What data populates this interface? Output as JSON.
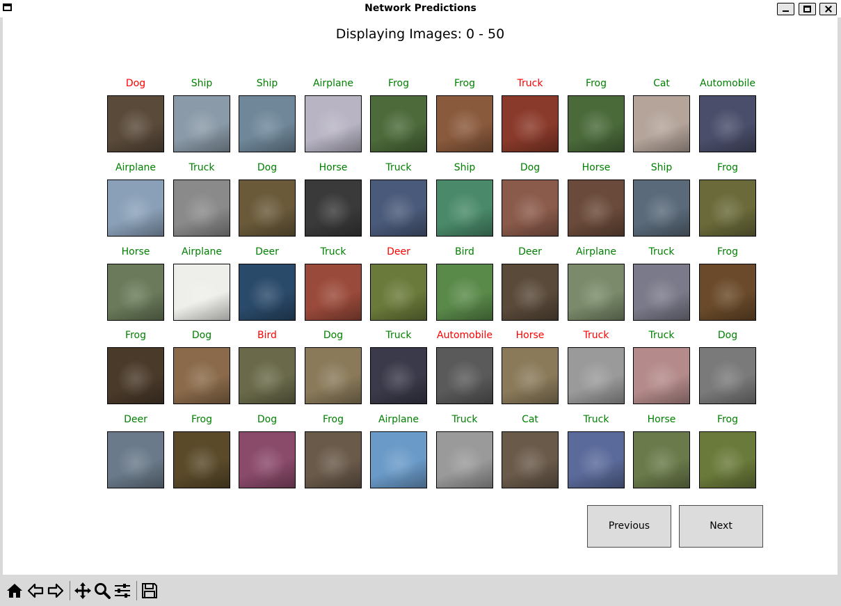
{
  "window": {
    "title": "Network Predictions"
  },
  "figure": {
    "title": "Displaying Images: 0 - 50"
  },
  "colors": {
    "correct": "#008000",
    "wrong": "#ff0000"
  },
  "grid": [
    [
      {
        "label": "Dog",
        "correct": false,
        "bg": "#5a4a3a"
      },
      {
        "label": "Ship",
        "correct": true,
        "bg": "#8a9aa8"
      },
      {
        "label": "Ship",
        "correct": true,
        "bg": "#6f8799"
      },
      {
        "label": "Airplane",
        "correct": true,
        "bg": "#b8b4c4"
      },
      {
        "label": "Frog",
        "correct": true,
        "bg": "#4c6a3a"
      },
      {
        "label": "Frog",
        "correct": true,
        "bg": "#8a5a3c"
      },
      {
        "label": "Truck",
        "correct": false,
        "bg": "#8a3a2a"
      },
      {
        "label": "Frog",
        "correct": true,
        "bg": "#4a6a3a"
      },
      {
        "label": "Cat",
        "correct": true,
        "bg": "#b4a49a"
      },
      {
        "label": "Automobile",
        "correct": true,
        "bg": "#4a4e6a"
      }
    ],
    [
      {
        "label": "Airplane",
        "correct": true,
        "bg": "#8aa0b8"
      },
      {
        "label": "Truck",
        "correct": true,
        "bg": "#8a8a8a"
      },
      {
        "label": "Dog",
        "correct": true,
        "bg": "#6a5a3a"
      },
      {
        "label": "Horse",
        "correct": true,
        "bg": "#3a3a3a"
      },
      {
        "label": "Truck",
        "correct": true,
        "bg": "#4a5a7a"
      },
      {
        "label": "Ship",
        "correct": true,
        "bg": "#4a8a6a"
      },
      {
        "label": "Dog",
        "correct": true,
        "bg": "#8a5a4a"
      },
      {
        "label": "Horse",
        "correct": true,
        "bg": "#6a4a3a"
      },
      {
        "label": "Ship",
        "correct": true,
        "bg": "#5a6a7a"
      },
      {
        "label": "Frog",
        "correct": true,
        "bg": "#6a6a3a"
      }
    ],
    [
      {
        "label": "Horse",
        "correct": true,
        "bg": "#6a7a5a"
      },
      {
        "label": "Airplane",
        "correct": true,
        "bg": "#eeeeea"
      },
      {
        "label": "Deer",
        "correct": true,
        "bg": "#2a4a6a"
      },
      {
        "label": "Truck",
        "correct": true,
        "bg": "#9a4a3a"
      },
      {
        "label": "Deer",
        "correct": false,
        "bg": "#6a7a3a"
      },
      {
        "label": "Bird",
        "correct": true,
        "bg": "#5a8a4a"
      },
      {
        "label": "Deer",
        "correct": true,
        "bg": "#5a4a3a"
      },
      {
        "label": "Airplane",
        "correct": true,
        "bg": "#7a8a6a"
      },
      {
        "label": "Truck",
        "correct": true,
        "bg": "#7a7a8a"
      },
      {
        "label": "Frog",
        "correct": true,
        "bg": "#6a4a2a"
      }
    ],
    [
      {
        "label": "Frog",
        "correct": true,
        "bg": "#4a3a2a"
      },
      {
        "label": "Dog",
        "correct": true,
        "bg": "#8a6a4a"
      },
      {
        "label": "Bird",
        "correct": false,
        "bg": "#6a6a4a"
      },
      {
        "label": "Dog",
        "correct": true,
        "bg": "#8a7a5a"
      },
      {
        "label": "Truck",
        "correct": true,
        "bg": "#3a3a4a"
      },
      {
        "label": "Automobile",
        "correct": false,
        "bg": "#5a5a5a"
      },
      {
        "label": "Horse",
        "correct": false,
        "bg": "#8a7a5a"
      },
      {
        "label": "Truck",
        "correct": false,
        "bg": "#9a9a9a"
      },
      {
        "label": "Truck",
        "correct": true,
        "bg": "#b48a8a"
      },
      {
        "label": "Dog",
        "correct": true,
        "bg": "#7a7a7a"
      }
    ],
    [
      {
        "label": "Deer",
        "correct": true,
        "bg": "#6a7a8a"
      },
      {
        "label": "Frog",
        "correct": true,
        "bg": "#5a4a2a"
      },
      {
        "label": "Dog",
        "correct": true,
        "bg": "#8a4a6a"
      },
      {
        "label": "Frog",
        "correct": true,
        "bg": "#6a5a4a"
      },
      {
        "label": "Airplane",
        "correct": true,
        "bg": "#6a9ac8"
      },
      {
        "label": "Truck",
        "correct": true,
        "bg": "#9a9a9a"
      },
      {
        "label": "Cat",
        "correct": true,
        "bg": "#6a5a4a"
      },
      {
        "label": "Truck",
        "correct": true,
        "bg": "#5a6a9a"
      },
      {
        "label": "Horse",
        "correct": true,
        "bg": "#6a7a4a"
      },
      {
        "label": "Frog",
        "correct": true,
        "bg": "#6a7a3a"
      }
    ]
  ],
  "buttons": {
    "previous": "Previous",
    "next": "Next"
  },
  "toolbar": {
    "icons": [
      "home-icon",
      "back-icon",
      "forward-icon",
      "pan-icon",
      "zoom-icon",
      "configure-subplots-icon",
      "save-icon"
    ]
  }
}
